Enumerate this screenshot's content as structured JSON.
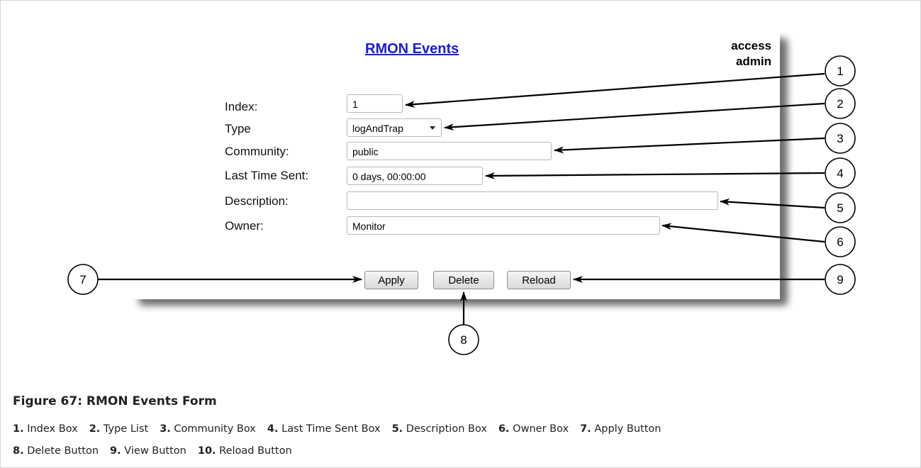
{
  "header": {
    "title": "RMON Events",
    "access_label": "access",
    "user": "admin"
  },
  "form": {
    "index": {
      "label": "Index:",
      "value": "1"
    },
    "type": {
      "label": "Type",
      "value": "logAndTrap"
    },
    "community": {
      "label": "Community:",
      "value": "public"
    },
    "last_time_sent": {
      "label": "Last Time Sent:",
      "value": "0 days, 00:00:00"
    },
    "description": {
      "label": "Description:",
      "value": ""
    },
    "owner": {
      "label": "Owner:",
      "value": "Monitor"
    }
  },
  "buttons": {
    "apply": "Apply",
    "delete": "Delete",
    "reload": "Reload"
  },
  "callouts": [
    "1",
    "2",
    "3",
    "4",
    "5",
    "6",
    "7",
    "8",
    "9"
  ],
  "caption": {
    "title": "Figure 67: RMON Events Form",
    "legend_line1": [
      {
        "num": "1.",
        "text": "Index Box"
      },
      {
        "num": "2.",
        "text": "Type List"
      },
      {
        "num": "3.",
        "text": "Community Box"
      },
      {
        "num": "4.",
        "text": "Last Time Sent Box"
      },
      {
        "num": "5.",
        "text": "Description Box"
      },
      {
        "num": "6.",
        "text": "Owner Box"
      },
      {
        "num": "7.",
        "text": "Apply Button"
      }
    ],
    "legend_line2": [
      {
        "num": "8.",
        "text": "Delete Button"
      },
      {
        "num": "9.",
        "text": "View Button"
      },
      {
        "num": "10.",
        "text": "Reload Button"
      }
    ]
  }
}
